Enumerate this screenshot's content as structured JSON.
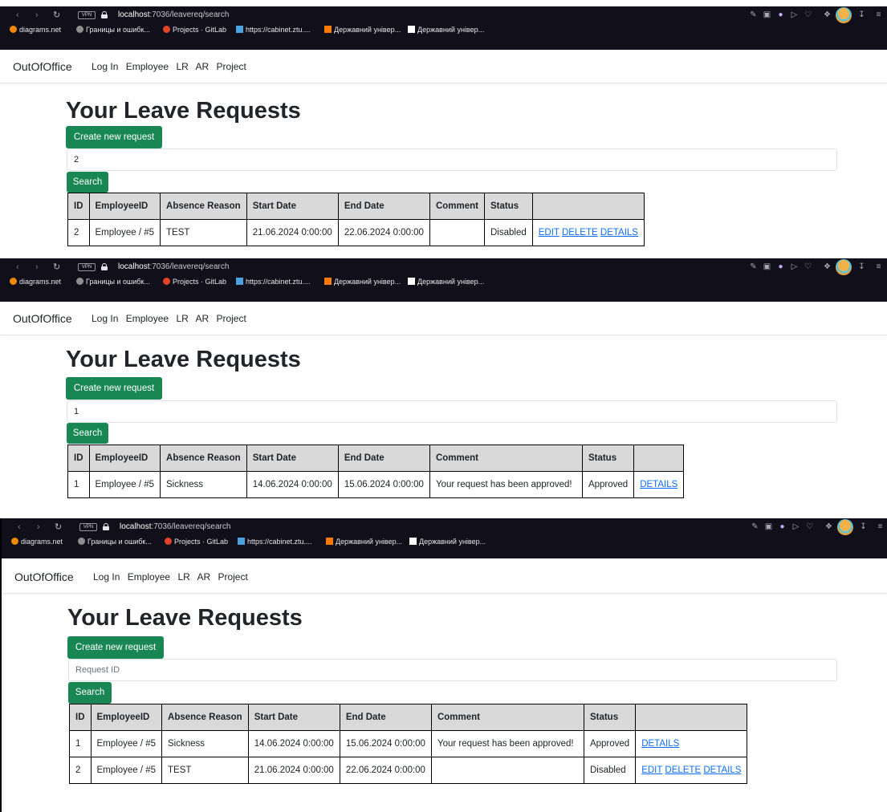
{
  "browser": {
    "url_host": "localhost",
    "url_rest": ":7036/leavereq/search",
    "vpn_badge": "VPN",
    "bookmarks": [
      {
        "label": "diagrams.net",
        "color": "#f08705"
      },
      {
        "label": "Границы и ошибк...",
        "color": "#8e8e8e"
      },
      {
        "label": "Projects · GitLab",
        "color": "#e24329"
      },
      {
        "label": "https://cabinet.ztu....",
        "color": "#4aa3df"
      },
      {
        "label": "Державний універ...",
        "color": "#ff7a00"
      },
      {
        "label": "Державний універ...",
        "color": "#ffffff"
      }
    ],
    "icons": [
      "back-icon",
      "forward-icon",
      "reload-icon",
      "lock-icon",
      "edit-icon",
      "camera-icon",
      "shield-icon",
      "play-icon",
      "heart-icon",
      "cube-icon",
      "avatar-icon",
      "download-icon",
      "menu-icon"
    ]
  },
  "navbar": {
    "brand": "OutOfOffice",
    "links": [
      "Log In",
      "Employee",
      "LR",
      "AR",
      "Project"
    ]
  },
  "page": {
    "title": "Your Leave Requests",
    "create_button": "Create new request",
    "search_button": "Search",
    "search_placeholder": "Request ID"
  },
  "table": {
    "headers": [
      "ID",
      "EmployeeID",
      "Absence Reason",
      "Start Date",
      "End Date",
      "Comment",
      "Status",
      ""
    ]
  },
  "rows": {
    "r1": {
      "id": "1",
      "employee": "Employee / #5",
      "reason": "Sickness",
      "start": "14.06.2024 0:00:00",
      "end": "15.06.2024 0:00:00",
      "comment": "Your request has been approved!",
      "status": "Approved"
    },
    "r2": {
      "id": "2",
      "employee": "Employee / #5",
      "reason": "TEST",
      "start": "21.06.2024 0:00:00",
      "end": "22.06.2024 0:00:00",
      "comment": "",
      "status": "Disabled"
    }
  },
  "actions": {
    "edit": "EDIT",
    "delete": "DELETE",
    "details": "DETAILS"
  },
  "screens": [
    {
      "search_value": "2"
    },
    {
      "search_value": "1"
    },
    {
      "search_value": ""
    }
  ],
  "colors": {
    "browser_bg": "#11101a",
    "button_green": "#198754",
    "link_blue": "#0d6efd",
    "table_header_bg": "#d9d9d9"
  }
}
